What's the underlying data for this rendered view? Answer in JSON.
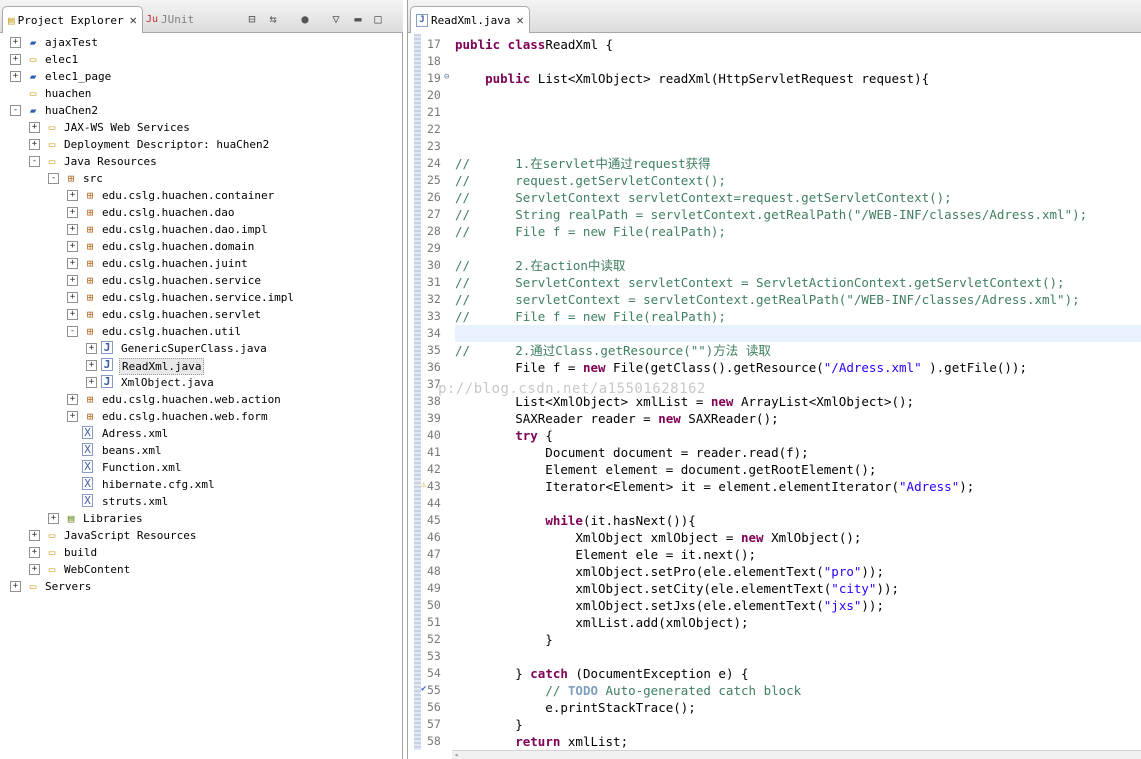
{
  "left_tabs": [
    {
      "label": "Project Explorer",
      "active": true
    },
    {
      "label": "JUnit",
      "active": false
    }
  ],
  "editor_tab": {
    "label": "ReadXml.java"
  },
  "tree": [
    {
      "label": "ajaxTest",
      "depth": 0,
      "exp": "+",
      "icon": "project"
    },
    {
      "label": "elec1",
      "depth": 0,
      "exp": "+",
      "icon": "folder"
    },
    {
      "label": "elec1_page",
      "depth": 0,
      "exp": "+",
      "icon": "project"
    },
    {
      "label": "huachen",
      "depth": 0,
      "exp": "",
      "icon": "folder"
    },
    {
      "label": "huaChen2",
      "depth": 0,
      "exp": "-",
      "icon": "project"
    },
    {
      "label": "JAX-WS Web Services",
      "depth": 1,
      "exp": "+",
      "icon": "folder"
    },
    {
      "label": "Deployment Descriptor: huaChen2",
      "depth": 1,
      "exp": "+",
      "icon": "folder"
    },
    {
      "label": "Java Resources",
      "depth": 1,
      "exp": "-",
      "icon": "folder"
    },
    {
      "label": "src",
      "depth": 2,
      "exp": "-",
      "icon": "package"
    },
    {
      "label": "edu.cslg.huachen.container",
      "depth": 3,
      "exp": "+",
      "icon": "package"
    },
    {
      "label": "edu.cslg.huachen.dao",
      "depth": 3,
      "exp": "+",
      "icon": "package"
    },
    {
      "label": "edu.cslg.huachen.dao.impl",
      "depth": 3,
      "exp": "+",
      "icon": "package"
    },
    {
      "label": "edu.cslg.huachen.domain",
      "depth": 3,
      "exp": "+",
      "icon": "package"
    },
    {
      "label": "edu.cslg.huachen.juint",
      "depth": 3,
      "exp": "+",
      "icon": "package"
    },
    {
      "label": "edu.cslg.huachen.service",
      "depth": 3,
      "exp": "+",
      "icon": "package"
    },
    {
      "label": "edu.cslg.huachen.service.impl",
      "depth": 3,
      "exp": "+",
      "icon": "package"
    },
    {
      "label": "edu.cslg.huachen.servlet",
      "depth": 3,
      "exp": "+",
      "icon": "package"
    },
    {
      "label": "edu.cslg.huachen.util",
      "depth": 3,
      "exp": "-",
      "icon": "package"
    },
    {
      "label": "GenericSuperClass.java",
      "depth": 4,
      "exp": "+",
      "icon": "java"
    },
    {
      "label": "ReadXml.java",
      "depth": 4,
      "exp": "+",
      "icon": "java",
      "selected": true
    },
    {
      "label": "XmlObject.java",
      "depth": 4,
      "exp": "+",
      "icon": "java"
    },
    {
      "label": "edu.cslg.huachen.web.action",
      "depth": 3,
      "exp": "+",
      "icon": "package"
    },
    {
      "label": "edu.cslg.huachen.web.form",
      "depth": 3,
      "exp": "+",
      "icon": "package"
    },
    {
      "label": "Adress.xml",
      "depth": 3,
      "exp": "",
      "icon": "xml"
    },
    {
      "label": "beans.xml",
      "depth": 3,
      "exp": "",
      "icon": "xml"
    },
    {
      "label": "Function.xml",
      "depth": 3,
      "exp": "",
      "icon": "xml"
    },
    {
      "label": "hibernate.cfg.xml",
      "depth": 3,
      "exp": "",
      "icon": "xml"
    },
    {
      "label": "struts.xml",
      "depth": 3,
      "exp": "",
      "icon": "xml"
    },
    {
      "label": "Libraries",
      "depth": 2,
      "exp": "+",
      "icon": "library"
    },
    {
      "label": "JavaScript Resources",
      "depth": 1,
      "exp": "+",
      "icon": "folder"
    },
    {
      "label": "build",
      "depth": 1,
      "exp": "+",
      "icon": "folder"
    },
    {
      "label": "WebContent",
      "depth": 1,
      "exp": "+",
      "icon": "folder"
    },
    {
      "label": "Servers",
      "depth": 0,
      "exp": "+",
      "icon": "folder"
    }
  ],
  "code_lines": [
    {
      "n": "17",
      "segs": [
        [
          "kw",
          "public class"
        ],
        [
          "",
          "ReadXml {"
        ]
      ]
    },
    {
      "n": "18",
      "segs": []
    },
    {
      "n": "19",
      "segs": [
        [
          "",
          "    "
        ],
        [
          "kw",
          "public"
        ],
        [
          "",
          " List<XmlObject> readXml(HttpServletRequest request){"
        ]
      ],
      "fold": "⊖"
    },
    {
      "n": "20",
      "segs": []
    },
    {
      "n": "21",
      "segs": []
    },
    {
      "n": "22",
      "segs": []
    },
    {
      "n": "23",
      "segs": []
    },
    {
      "n": "24",
      "segs": [
        [
          "cm",
          "//      1.在servlet中通过request获得"
        ]
      ]
    },
    {
      "n": "25",
      "segs": [
        [
          "cm",
          "//      request.getServletContext();"
        ]
      ]
    },
    {
      "n": "26",
      "segs": [
        [
          "cm",
          "//      ServletContext servletContext=request.getServletContext();"
        ]
      ]
    },
    {
      "n": "27",
      "segs": [
        [
          "cm",
          "//      String realPath = servletContext.getRealPath(\"/WEB-INF/classes/Adress.xml\");"
        ]
      ]
    },
    {
      "n": "28",
      "segs": [
        [
          "cm",
          "//      File f = new File(realPath);"
        ]
      ]
    },
    {
      "n": "29",
      "segs": []
    },
    {
      "n": "30",
      "segs": [
        [
          "cm",
          "//      2.在action中读取"
        ]
      ]
    },
    {
      "n": "31",
      "segs": [
        [
          "cm",
          "//      ServletContext servletContext = ServletActionContext.getServletContext();"
        ]
      ]
    },
    {
      "n": "32",
      "segs": [
        [
          "cm",
          "//      servletContext = servletContext.getRealPath(\"/WEB-INF/classes/Adress.xml\");"
        ]
      ]
    },
    {
      "n": "33",
      "segs": [
        [
          "cm",
          "//      File f = new File(realPath);"
        ]
      ]
    },
    {
      "n": "34",
      "segs": [],
      "current": true
    },
    {
      "n": "35",
      "segs": [
        [
          "cm",
          "//      2.通过Class.getResource(\"\")方法 读取"
        ]
      ]
    },
    {
      "n": "36",
      "segs": [
        [
          "",
          "        File f = "
        ],
        [
          "kw",
          "new"
        ],
        [
          "",
          " File(getClass().getResource("
        ],
        [
          "st",
          "\"/Adress.xml\""
        ],
        [
          "",
          " ).getFile());"
        ]
      ]
    },
    {
      "n": "37",
      "segs": []
    },
    {
      "n": "38",
      "segs": [
        [
          "",
          "        List<XmlObject> xmlList = "
        ],
        [
          "kw",
          "new"
        ],
        [
          "",
          " ArrayList<XmlObject>();"
        ]
      ]
    },
    {
      "n": "39",
      "segs": [
        [
          "",
          "        SAXReader reader = "
        ],
        [
          "kw",
          "new"
        ],
        [
          "",
          " SAXReader();"
        ]
      ]
    },
    {
      "n": "40",
      "segs": [
        [
          "",
          "        "
        ],
        [
          "kw",
          "try"
        ],
        [
          "",
          " {"
        ]
      ]
    },
    {
      "n": "41",
      "segs": [
        [
          "",
          "            Document document = reader.read(f);"
        ]
      ]
    },
    {
      "n": "42",
      "segs": [
        [
          "",
          "            Element element = document.getRootElement();"
        ]
      ]
    },
    {
      "n": "43",
      "segs": [
        [
          "",
          "            Iterator<Element> it = element.elementIterator("
        ],
        [
          "st",
          "\"Adress\""
        ],
        [
          "",
          ");"
        ]
      ],
      "marker": "warning"
    },
    {
      "n": "44",
      "segs": []
    },
    {
      "n": "45",
      "segs": [
        [
          "",
          "            "
        ],
        [
          "kw",
          "while"
        ],
        [
          "",
          "(it.hasNext()){"
        ]
      ]
    },
    {
      "n": "46",
      "segs": [
        [
          "",
          "                XmlObject xmlObject = "
        ],
        [
          "kw",
          "new"
        ],
        [
          "",
          " XmlObject();"
        ]
      ]
    },
    {
      "n": "47",
      "segs": [
        [
          "",
          "                Element ele = it.next();"
        ]
      ]
    },
    {
      "n": "48",
      "segs": [
        [
          "",
          "                xmlObject.setPro(ele.elementText("
        ],
        [
          "st",
          "\"pro\""
        ],
        [
          "",
          "));"
        ]
      ]
    },
    {
      "n": "49",
      "segs": [
        [
          "",
          "                xmlObject.setCity(ele.elementText("
        ],
        [
          "st",
          "\"city\""
        ],
        [
          "",
          "));"
        ]
      ]
    },
    {
      "n": "50",
      "segs": [
        [
          "",
          "                xmlObject.setJxs(ele.elementText("
        ],
        [
          "st",
          "\"jxs\""
        ],
        [
          "",
          "));"
        ]
      ]
    },
    {
      "n": "51",
      "segs": [
        [
          "",
          "                xmlList.add(xmlObject);"
        ]
      ]
    },
    {
      "n": "52",
      "segs": [
        [
          "",
          "            }"
        ]
      ]
    },
    {
      "n": "53",
      "segs": []
    },
    {
      "n": "54",
      "segs": [
        [
          "",
          "        } "
        ],
        [
          "kw",
          "catch"
        ],
        [
          "",
          " (DocumentException e) {"
        ]
      ]
    },
    {
      "n": "55",
      "segs": [
        [
          "",
          "            "
        ],
        [
          "cm",
          "// "
        ],
        [
          "todo",
          "TODO"
        ],
        [
          "cm",
          " Auto-generated catch block"
        ]
      ],
      "marker": "task"
    },
    {
      "n": "56",
      "segs": [
        [
          "",
          "            e.printStackTrace();"
        ]
      ]
    },
    {
      "n": "57",
      "segs": [
        [
          "",
          "        }"
        ]
      ]
    },
    {
      "n": "58",
      "segs": [
        [
          "",
          "        "
        ],
        [
          "kw",
          "return"
        ],
        [
          "",
          " xmlList;"
        ]
      ]
    }
  ],
  "watermark": "p://blog.csdn.net/a15501628162"
}
